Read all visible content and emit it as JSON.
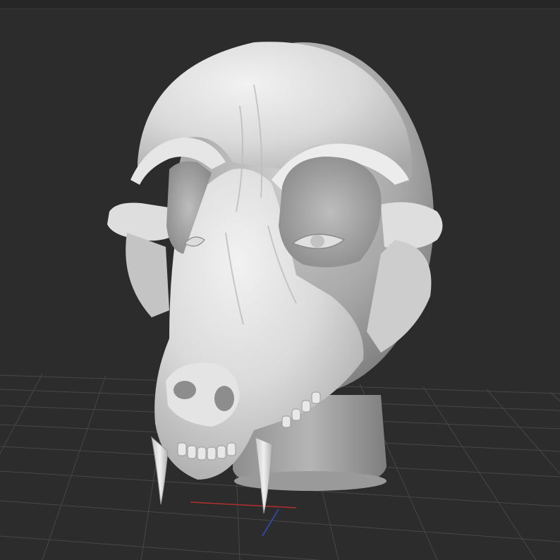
{
  "viewport": {
    "title": "",
    "model": "wolf-skull-mask-on-head",
    "background_color": "#2c2c2c",
    "grid_color": "#4a4a4a",
    "axis_x_color": "#b03030",
    "axis_z_color": "#3050c0",
    "material_color": "#d9d9d9"
  }
}
